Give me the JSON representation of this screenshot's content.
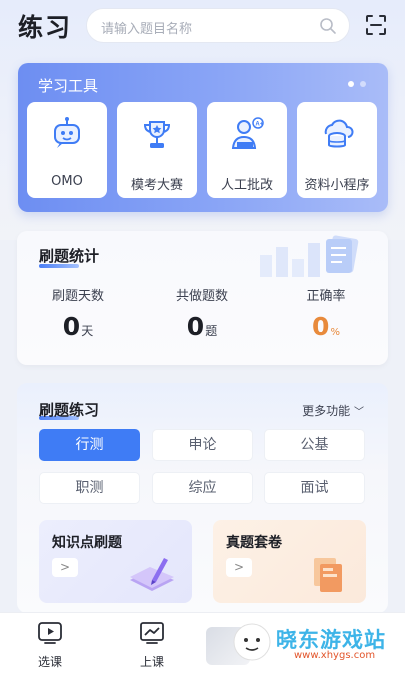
{
  "header": {
    "title": "练习",
    "search_placeholder": "请输入题目名称"
  },
  "tools": {
    "title": "学习工具",
    "page_dots": 2,
    "items": [
      {
        "label": "OMO",
        "icon": "robot-icon"
      },
      {
        "label": "模考大赛",
        "icon": "trophy-icon"
      },
      {
        "label": "人工批改",
        "icon": "teacher-icon"
      },
      {
        "label": "资料小程序",
        "icon": "database-icon"
      }
    ]
  },
  "stats": {
    "title": "刷题统计",
    "items": [
      {
        "label": "刷题天数",
        "value": "0",
        "unit": "天"
      },
      {
        "label": "共做题数",
        "value": "0",
        "unit": "题"
      },
      {
        "label": "正确率",
        "value": "0",
        "unit": "%"
      }
    ]
  },
  "practice": {
    "title": "刷题练习",
    "more": "更多功能",
    "chips": [
      "行测",
      "申论",
      "公基",
      "职测",
      "综应",
      "面试"
    ],
    "cards": [
      {
        "title": "知识点刷题",
        "arrow": ">"
      },
      {
        "title": "真题套卷",
        "arrow": ">"
      }
    ]
  },
  "tabbar": {
    "items": [
      {
        "label": "选课",
        "icon": "play-video-icon"
      },
      {
        "label": "上课",
        "icon": "chart-screen-icon"
      }
    ]
  },
  "watermark": {
    "text": "晓东游戏站",
    "url": "www.xhygs.com"
  },
  "colors": {
    "accent": "#3f7cf5",
    "orange": "#e88a3c"
  }
}
